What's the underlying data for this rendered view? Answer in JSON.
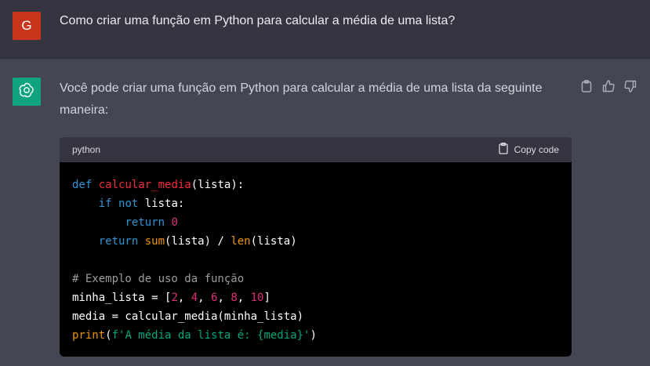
{
  "user": {
    "avatar_letter": "G",
    "avatar_color": "#c7361c",
    "message": "Como criar uma função em Python para calcular a média de uma lista?"
  },
  "assistant": {
    "avatar_color": "#10a37f",
    "avatar_icon": "openai-logo-icon",
    "message": "Você pode criar uma função em Python para calcular a média de uma lista da seguinte maneira:",
    "actions": [
      "clipboard-icon",
      "thumbs-up-icon",
      "thumbs-down-icon"
    ]
  },
  "code": {
    "language": "python",
    "copy_label": "Copy code",
    "lines": {
      "l1_def": "def",
      "l1_name": "calcular_media",
      "l1_rest": "(lista):",
      "l2_if": "if",
      "l2_not": "not",
      "l2_rest": " lista:",
      "l3_return": "return",
      "l3_zero": "0",
      "l4_return": "return",
      "l4_sum": "sum",
      "l4_mid": "(lista) / ",
      "l4_len": "len",
      "l4_end": "(lista)",
      "l6_comment": "# Exemplo de uso da função",
      "l7_start": "minha_lista = [",
      "n2": "2",
      "n4": "4",
      "n6": "6",
      "n8": "8",
      "n10": "10",
      "l7_end": "]",
      "l8": "media = calcular_media(minha_lista)",
      "l9_print": "print",
      "l9_open": "(",
      "l9_str": "f'A média da lista é: {media}'",
      "l9_close": ")"
    }
  }
}
